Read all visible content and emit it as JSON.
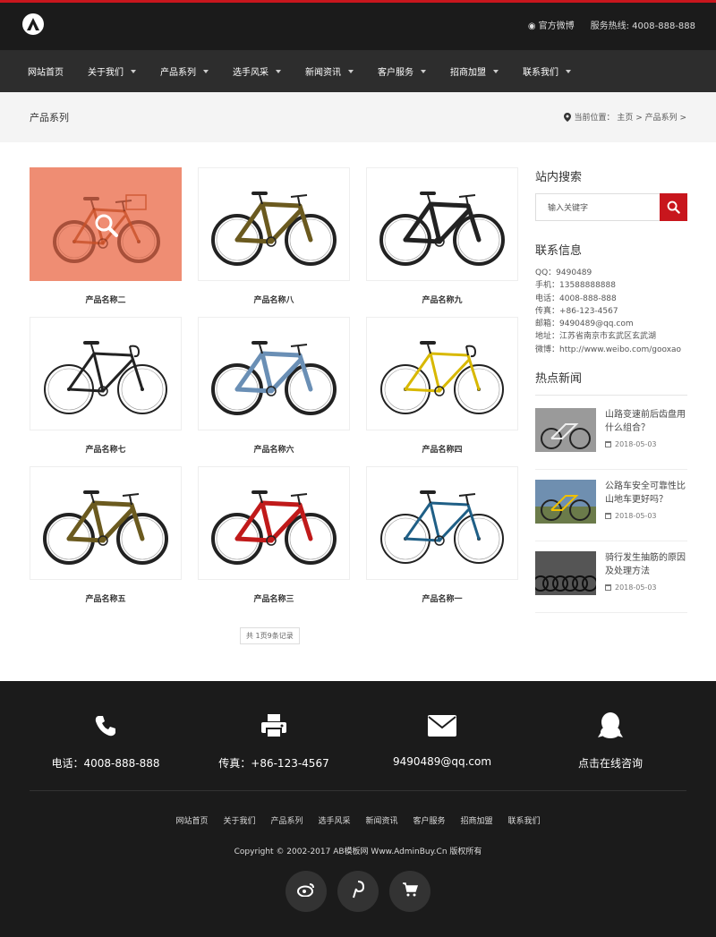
{
  "header": {
    "weibo_label": "官方微博",
    "hotline_label": "服务热线: 4008-888-888"
  },
  "nav": [
    {
      "label": "网站首页",
      "dropdown": false
    },
    {
      "label": "关于我们",
      "dropdown": true
    },
    {
      "label": "产品系列",
      "dropdown": true
    },
    {
      "label": "选手风采",
      "dropdown": true
    },
    {
      "label": "新闻资讯",
      "dropdown": true
    },
    {
      "label": "客户服务",
      "dropdown": true
    },
    {
      "label": "招商加盟",
      "dropdown": true
    },
    {
      "label": "联系我们",
      "dropdown": true
    }
  ],
  "page": {
    "title": "产品系列",
    "breadcrumb": "当前位置： 主页 > 产品系列 >"
  },
  "products": [
    {
      "name": "产品名称二",
      "color": "#e66a3c",
      "style": "kids"
    },
    {
      "name": "产品名称八",
      "color": "#6b5a1f",
      "style": "mtb"
    },
    {
      "name": "产品名称九",
      "color": "#222222",
      "style": "mtb"
    },
    {
      "name": "产品名称七",
      "color": "#222222",
      "style": "road"
    },
    {
      "name": "产品名称六",
      "color": "#6a8fb5",
      "style": "mtb"
    },
    {
      "name": "产品名称四",
      "color": "#d8b800",
      "style": "road"
    },
    {
      "name": "产品名称五",
      "color": "#6b5a1f",
      "style": "mtb"
    },
    {
      "name": "产品名称三",
      "color": "#c01a1a",
      "style": "mtb"
    },
    {
      "name": "产品名称一",
      "color": "#1f5f86",
      "style": "hybrid"
    }
  ],
  "pager": "共 1页9条记录",
  "sidebar": {
    "search_title": "站内搜索",
    "search_placeholder": "输入关键字",
    "contact_title": "联系信息",
    "contact_lines": [
      "QQ：9490489",
      "手机：13588888888",
      "电话：4008-888-888",
      "传真：+86-123-4567",
      "邮箱：9490489@qq.com",
      "地址：江苏省南京市玄武区玄武湖",
      "微博：http://www.weibo.com/gooxao"
    ],
    "news_title": "热点新闻",
    "news": [
      {
        "title": "山路变速前后齿盘用什么组合？",
        "date": "2018-05-03"
      },
      {
        "title": "公路车安全可靠性比山地车更好吗？",
        "date": "2018-05-03"
      },
      {
        "title": "骑行发生抽筋的原因及处理方法",
        "date": "2018-05-03"
      }
    ]
  },
  "footer": {
    "contacts": [
      {
        "icon": "phone-icon",
        "label": "电话：4008-888-888"
      },
      {
        "icon": "printer-icon",
        "label": "传真：+86-123-4567"
      },
      {
        "icon": "mail-icon",
        "label": "9490489@qq.com"
      },
      {
        "icon": "qq-icon",
        "label": "点击在线咨询"
      }
    ],
    "links": [
      "网站首页",
      "关于我们",
      "产品系列",
      "选手风采",
      "新闻资讯",
      "客户服务",
      "招商加盟",
      "联系我们"
    ],
    "copyright": "Copyright © 2002-2017 AB模板网 Www.AdminBuy.Cn 版权所有",
    "social": [
      "weibo-icon",
      "pinterest-icon",
      "cart-icon"
    ]
  },
  "colors": {
    "accent": "#c8161d",
    "dark": "#1b1b1b",
    "nav": "#2d2d2d"
  }
}
